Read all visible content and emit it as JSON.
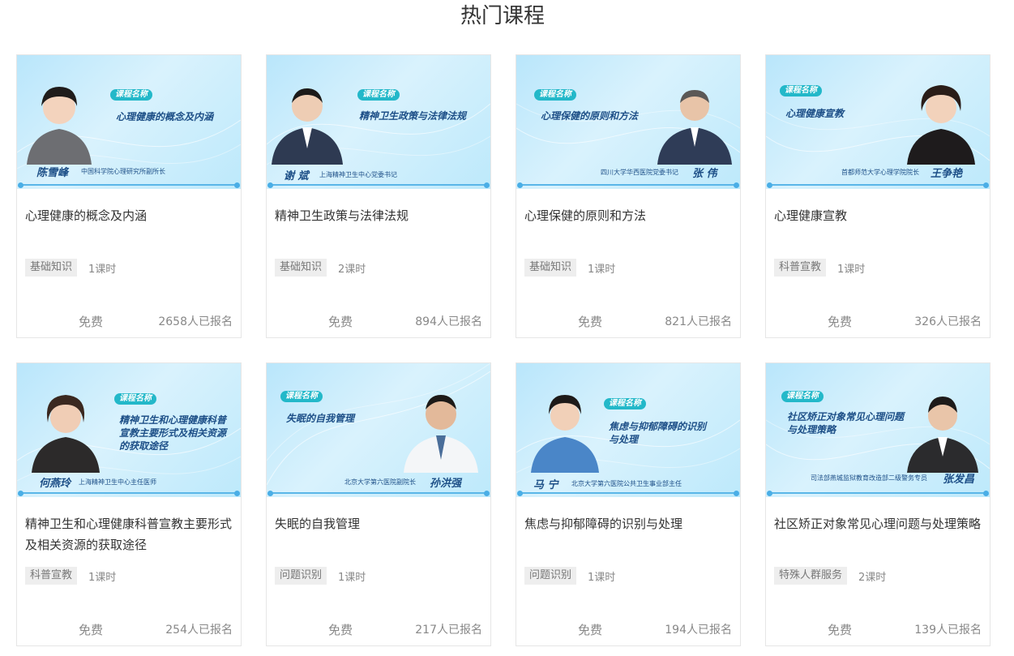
{
  "section": {
    "title": "热门课程"
  },
  "banner_tag": "课程名称",
  "courses": [
    {
      "title": "心理健康的概念及内涵",
      "banner_title": "心理健康的概念及内涵",
      "lecturer": "陈雪峰",
      "lecturer_title": "中国科学院心理研究所副所长",
      "category": "基础知识",
      "duration": "1课时",
      "price": "免费",
      "enrolled": "2658人已报名"
    },
    {
      "title": "精神卫生政策与法律法规",
      "banner_title": "精神卫生政策与法律法规",
      "lecturer": "谢 斌",
      "lecturer_title": "上海精神卫生中心党委书记",
      "category": "基础知识",
      "duration": "2课时",
      "price": "免费",
      "enrolled": "894人已报名"
    },
    {
      "title": "心理保健的原则和方法",
      "banner_title": "心理保健的原则和方法",
      "lecturer": "张 伟",
      "lecturer_title": "四川大学华西医院党委书记",
      "category": "基础知识",
      "duration": "1课时",
      "price": "免费",
      "enrolled": "821人已报名"
    },
    {
      "title": "心理健康宣教",
      "banner_title": "心理健康宣教",
      "lecturer": "王争艳",
      "lecturer_title": "首都师范大学心理学院院长",
      "category": "科普宣教",
      "duration": "1课时",
      "price": "免费",
      "enrolled": "326人已报名"
    },
    {
      "title": "精神卫生和心理健康科普宣教主要形式及相关资源的获取途径",
      "banner_title": "精神卫生和心理健康科普\n宣教主要形式及相关资源\n的获取途径",
      "lecturer": "何燕玲",
      "lecturer_title": "上海精神卫生中心主任医师",
      "category": "科普宣教",
      "duration": "1课时",
      "price": "免费",
      "enrolled": "254人已报名"
    },
    {
      "title": "失眠的自我管理",
      "banner_title": "失眠的自我管理",
      "lecturer": "孙洪强",
      "lecturer_title": "北京大学第六医院副院长",
      "category": "问题识别",
      "duration": "1课时",
      "price": "免费",
      "enrolled": "217人已报名"
    },
    {
      "title": "焦虑与抑郁障碍的识别与处理",
      "banner_title": "焦虑与抑郁障碍的识别\n与处理",
      "lecturer": "马 宁",
      "lecturer_title": "北京大学第六医院公共卫生事业部主任",
      "category": "问题识别",
      "duration": "1课时",
      "price": "免费",
      "enrolled": "194人已报名"
    },
    {
      "title": "社区矫正对象常见心理问题与处理策略",
      "banner_title": "社区矫正对象常见心理问题\n与处理策略",
      "lecturer": "张发昌",
      "lecturer_title": "司法部燕城监狱教育改造部二级警务专员",
      "category": "特殊人群服务",
      "duration": "2课时",
      "price": "免费",
      "enrolled": "139人已报名"
    }
  ]
}
